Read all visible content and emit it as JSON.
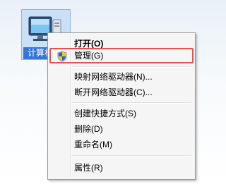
{
  "desktop": {
    "computer_icon_label": "计算机"
  },
  "context_menu": {
    "items": [
      {
        "label": "打开(O)"
      },
      {
        "label": "管理(G)"
      },
      {
        "label": "映射网络驱动器(N)..."
      },
      {
        "label": "断开网络驱动器(C)..."
      },
      {
        "label": "创建快捷方式(S)"
      },
      {
        "label": "删除(D)"
      },
      {
        "label": "重命名(M)"
      },
      {
        "label": "属性(R)"
      }
    ]
  },
  "colors": {
    "highlight_box": "#e05454",
    "selection": "#3875d7"
  },
  "icons": {
    "desktop_icon": "computer-monitor-icon",
    "manage_icon": "uac-shield-icon"
  }
}
